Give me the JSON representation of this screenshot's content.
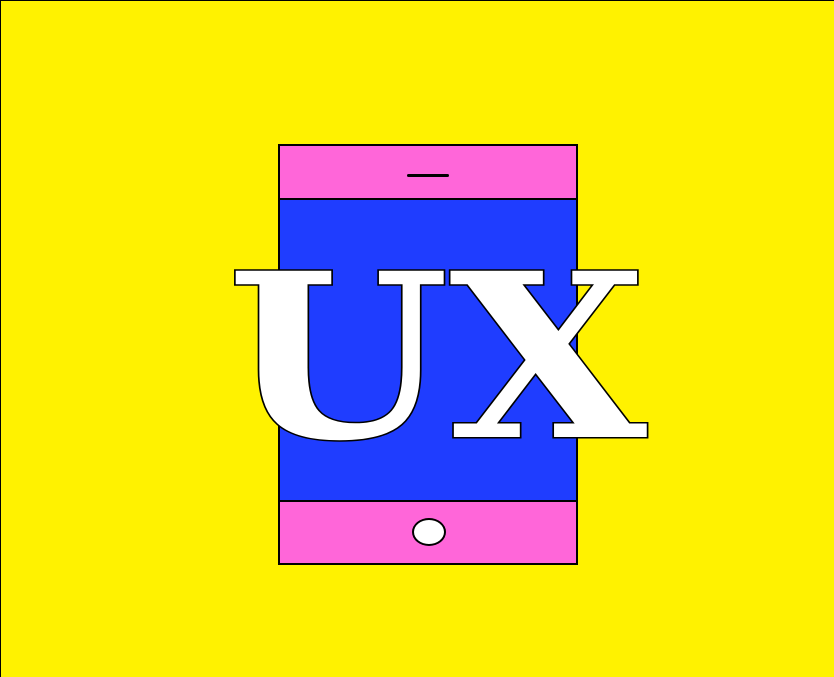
{
  "illustration": {
    "title_text": "UX",
    "colors": {
      "background": "#FFF200",
      "device_body": "#1F3DFF",
      "device_bezel": "#FF66D9",
      "text_fill": "#FFFFFF",
      "outline": "#000000"
    },
    "icons": {
      "device": "tablet-icon",
      "speaker": "speaker-slot-icon",
      "home_button": "home-button-icon"
    }
  }
}
